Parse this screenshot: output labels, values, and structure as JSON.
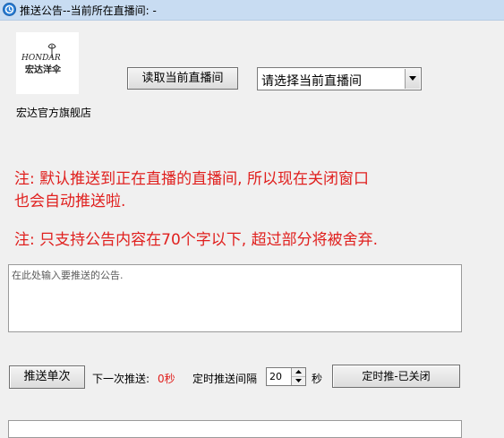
{
  "window": {
    "title": "推送公告--当前所在直播间: -",
    "app_icon": "live-app-icon"
  },
  "shop": {
    "logo_alt": "HONDAR 宏达洋伞",
    "name": "宏达官方旗舰店"
  },
  "controls": {
    "read_button": "读取当前直播间",
    "room_select_value": "请选择当前直播间"
  },
  "notes": {
    "line1": "注: 默认推送到正在直播的直播间, 所以现在关闭窗口",
    "line2": "也会自动推送啦.",
    "line3": "注: 只支持公告内容在70个字以下, 超过部分将被舍弃."
  },
  "announcement": {
    "placeholder": "在此处输入要推送的公告."
  },
  "push": {
    "single_button": "推送单次",
    "next_label": "下一次推送:",
    "next_value": "0秒",
    "interval_label": "定时推送间隔",
    "interval_value": "20",
    "seconds_label": "秒",
    "timer_button": "定时推-已关闭"
  },
  "colors": {
    "note_red": "#e0201e",
    "titlebar": "#c8dcf2",
    "background": "#f0f0f0"
  }
}
